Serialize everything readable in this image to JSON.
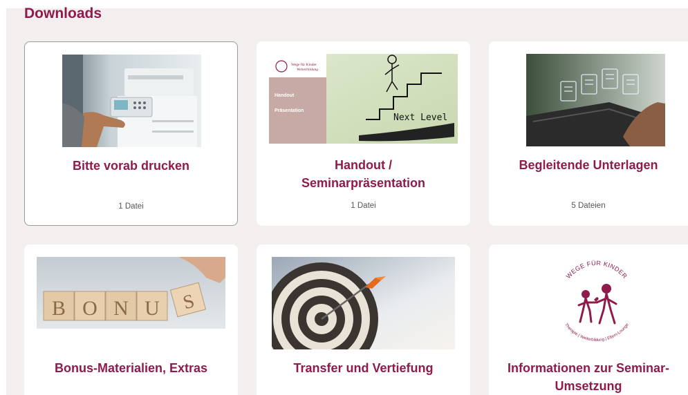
{
  "section": {
    "title": "Downloads"
  },
  "cards": [
    {
      "title": "Bitte vorab drucken",
      "count": "1 Datei",
      "image": "printer-photo"
    },
    {
      "title_line1": "Handout /",
      "title_line2": "Seminarpräsentation",
      "count": "1 Datei",
      "image": "next-level-stairs",
      "thumb_labels": {
        "item1": "Handout",
        "item2": "Präsentation",
        "next_level": "Next Level",
        "logo_line1": "Wege für Kinder",
        "logo_line2": "Weiterbildung"
      }
    },
    {
      "title": "Begleitende Unterlagen",
      "count": "5 Dateien",
      "image": "laptop-documents-photo"
    },
    {
      "title": "Bonus-Materialien, Extras",
      "image": "bonus-blocks",
      "thumb_letters": [
        "B",
        "O",
        "N",
        "U",
        "S"
      ]
    },
    {
      "title": "Transfer und Vertiefung",
      "image": "dartboard-photo"
    },
    {
      "title_line1": "Informationen zur Seminar-",
      "title_line2": "Umsetzung",
      "image": "wege-fuer-kinder-logo",
      "logo": {
        "top": "WEGE FÜR KINDER",
        "bottom": "Therapie | Weiterbildung | Eltern-Lounge"
      }
    }
  ],
  "colors": {
    "brand": "#8e1b4b",
    "panel": "#f3efee"
  }
}
